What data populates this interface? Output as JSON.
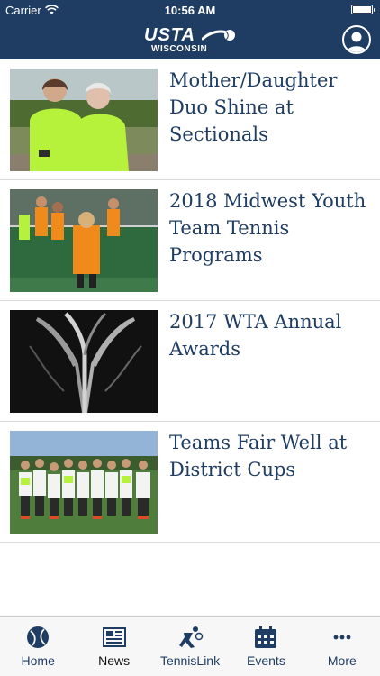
{
  "status": {
    "carrier": "Carrier",
    "time": "10:56 AM",
    "battery_level": 1.0
  },
  "header": {
    "logo_main": "USTA",
    "logo_sub": "WISCONSIN",
    "icons": {
      "profile": "person-icon"
    }
  },
  "news": [
    {
      "headline": "Mother/Daughter Duo Shine at Sectionals",
      "image": "two-women-green-shirts-photo"
    },
    {
      "headline": "2018 Midwest Youth Team Tennis Programs",
      "image": "kids-orange-shirts-tennis-photo"
    },
    {
      "headline": "2017 WTA Annual Awards",
      "image": "silver-trophy-photo"
    },
    {
      "headline": "Teams Fair Well at District Cups",
      "image": "junior-team-group-photo"
    }
  ],
  "tabs": [
    {
      "label": "Home",
      "icon": "tennis-ball-icon",
      "active": false
    },
    {
      "label": "News",
      "icon": "newspaper-icon",
      "active": true
    },
    {
      "label": "TennisLink",
      "icon": "player-icon",
      "active": false
    },
    {
      "label": "Events",
      "icon": "calendar-icon",
      "active": false
    },
    {
      "label": "More",
      "icon": "ellipsis-icon",
      "active": false
    }
  ],
  "colors": {
    "brand_navy": "#1f3d63",
    "accent_neon": "#b6f23c"
  }
}
